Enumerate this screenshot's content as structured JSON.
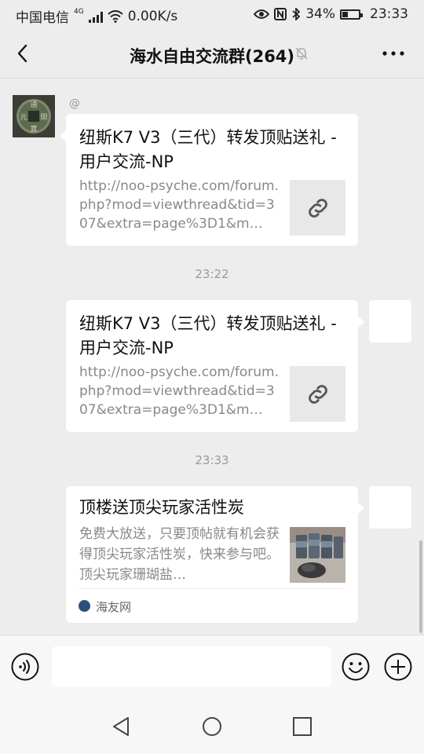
{
  "status_bar": {
    "carrier": "中国电信",
    "network_type": "4G",
    "speed": "0.00K/s",
    "battery": "34%",
    "battery_level": 0.34,
    "time": "23:33"
  },
  "nav": {
    "title": "海水自由交流群(264)",
    "back_icon": "chevron-left-icon",
    "mute_icon": "bell-off-icon",
    "more_icon": "ellipsis-icon"
  },
  "messages": [
    {
      "sender": "other",
      "at_label": "@",
      "title": "纽斯K7 V3（三代）转发顶贴送礼 - 用户交流-NP",
      "desc": "http://noo-psyche.com/forum.php?mod=viewthread&tid=307&extra=page%3D1&m…",
      "thumb_icon": "link-icon"
    },
    {
      "time": "23:22"
    },
    {
      "sender": "self",
      "title": "纽斯K7 V3（三代）转发顶贴送礼 - 用户交流-NP",
      "desc": "http://noo-psyche.com/forum.php?mod=viewthread&tid=307&extra=page%3D1&m…",
      "thumb_icon": "link-icon"
    },
    {
      "time": "23:33"
    },
    {
      "sender": "self",
      "title": "顶楼送顶尖玩家活性炭",
      "desc": "免费大放送，只要顶帖就有机会获得顶尖玩家活性炭，快来参与吧。顶尖玩家珊瑚盐…",
      "thumb_icon": "product-photo",
      "source": "海友网"
    }
  ],
  "input_bar": {
    "placeholder": "",
    "voice_icon": "voice-icon",
    "emoji_icon": "emoji-icon",
    "plus_icon": "plus-icon"
  },
  "system_nav": {
    "back_icon": "triangle-back-icon",
    "home_icon": "circle-home-icon",
    "recents_icon": "square-recents-icon"
  },
  "colors": {
    "background": "#ededed",
    "card": "#ffffff",
    "muted_text": "#888888"
  }
}
